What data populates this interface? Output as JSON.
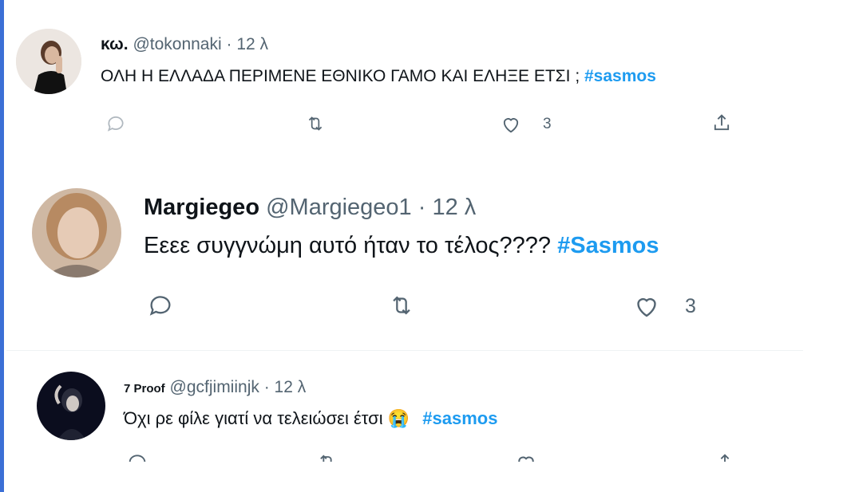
{
  "tweets": [
    {
      "name": "κω.",
      "handle": "@tokonnaki",
      "time": "· 12 λ",
      "text": "ΟΛΗ Η ΕΛΛΑΔΑ ΠΕΡΙΜΕΝΕ ΕΘΝΙΚΟ ΓΑΜΟ ΚΑΙ ΕΛΗΞΕ ΕΤΣΙ ; ",
      "hashtag": "#sasmos",
      "likes": "3",
      "icons": [
        "reply-icon",
        "retweet-icon",
        "heart-icon",
        "share-icon"
      ]
    },
    {
      "name": "Margiegeo",
      "handle": "@Margiegeo1",
      "time": "· 12 λ",
      "text": "Εεεε συγγνώμη αυτό ήταν το τέλος???? ",
      "hashtag": "#Sasmos",
      "likes": "3",
      "icons": [
        "reply-icon",
        "retweet-icon",
        "heart-icon"
      ]
    },
    {
      "name": "7 Proof",
      "handle": "@gcfjimiinjk",
      "time": "· 12 λ",
      "text": "Όχι ρε φίλε γιατί να τελειώσει έτσι ",
      "emoji": "😭",
      "hashtag": "#sasmos",
      "icons": [
        "reply-icon",
        "retweet-icon",
        "heart-icon",
        "share-icon"
      ]
    }
  ],
  "colors": {
    "hashtag": "#1d9bf0",
    "muted": "#536471",
    "left_bar": "#3b6fd6"
  }
}
